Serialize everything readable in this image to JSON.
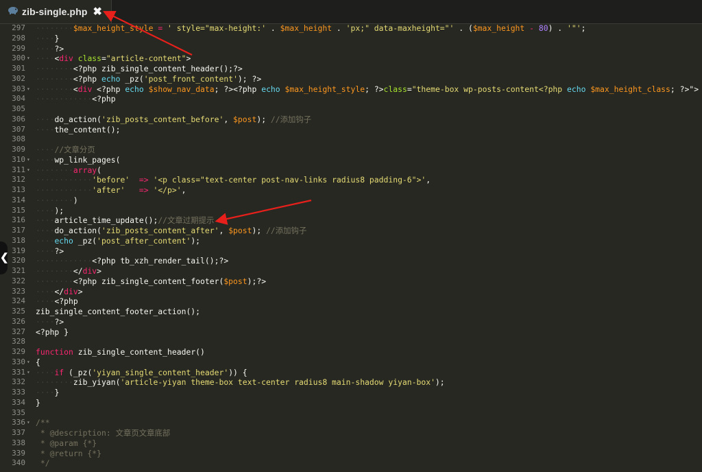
{
  "tab": {
    "icon": "php-elephant-icon",
    "label": "zib-single.php",
    "close_glyph": "✖"
  },
  "sidebar_toggle_glyph": "❮",
  "colors": {
    "background": "#272822",
    "keyword": "#f92672",
    "variable": "#fd971f",
    "string": "#e6db74",
    "comment": "#75715e",
    "echo": "#66d9ef",
    "number": "#ae81ff",
    "annotation_arrow": "#e8201b"
  },
  "lines": [
    {
      "n": "297",
      "fold": false,
      "tokens": [
        [
          "ws",
          "········"
        ],
        [
          "var",
          "$max_height_style"
        ],
        [
          "p",
          " "
        ],
        [
          "kw",
          "="
        ],
        [
          "p",
          " "
        ],
        [
          "str",
          "' style=\"max-height:'"
        ],
        [
          "p",
          " . "
        ],
        [
          "var",
          "$max_height"
        ],
        [
          "p",
          " . "
        ],
        [
          "str",
          "'px;\" data-maxheight=\"'"
        ],
        [
          "p",
          " . ("
        ],
        [
          "var",
          "$max_height"
        ],
        [
          "p",
          " "
        ],
        [
          "kw",
          "-"
        ],
        [
          "p",
          " "
        ],
        [
          "num",
          "80"
        ],
        [
          "p",
          ") . "
        ],
        [
          "str",
          "'\"'"
        ],
        [
          "p",
          ";"
        ]
      ]
    },
    {
      "n": "298",
      "fold": false,
      "tokens": [
        [
          "ws",
          "····"
        ],
        [
          "p",
          "}"
        ]
      ]
    },
    {
      "n": "299",
      "fold": false,
      "tokens": [
        [
          "ws",
          "····"
        ],
        [
          "p",
          "?>"
        ]
      ]
    },
    {
      "n": "300",
      "fold": true,
      "tokens": [
        [
          "ws",
          "····"
        ],
        [
          "p",
          "<"
        ],
        [
          "kw",
          "div"
        ],
        [
          "p",
          " "
        ],
        [
          "attr",
          "class"
        ],
        [
          "p",
          "="
        ],
        [
          "str",
          "\"article-content\""
        ],
        [
          "p",
          ">"
        ]
      ]
    },
    {
      "n": "301",
      "fold": false,
      "tokens": [
        [
          "ws",
          "········"
        ],
        [
          "p",
          "<?php zib_single_content_header();?>"
        ]
      ]
    },
    {
      "n": "302",
      "fold": false,
      "tokens": [
        [
          "ws",
          "········"
        ],
        [
          "p",
          "<?php "
        ],
        [
          "echo",
          "echo"
        ],
        [
          "p",
          " _pz("
        ],
        [
          "str",
          "'post_front_content'"
        ],
        [
          "p",
          "); ?>"
        ]
      ]
    },
    {
      "n": "303",
      "fold": true,
      "tokens": [
        [
          "ws",
          "········"
        ],
        [
          "p",
          "<"
        ],
        [
          "kw",
          "div"
        ],
        [
          "p",
          " <?php "
        ],
        [
          "echo",
          "echo"
        ],
        [
          "p",
          " "
        ],
        [
          "var",
          "$show_nav_data"
        ],
        [
          "p",
          "; ?><?php "
        ],
        [
          "echo",
          "echo"
        ],
        [
          "p",
          " "
        ],
        [
          "var",
          "$max_height_style"
        ],
        [
          "p",
          "; ?>"
        ],
        [
          "attr",
          "class"
        ],
        [
          "p",
          "="
        ],
        [
          "str",
          "\"theme-box wp-posts-content<?php "
        ],
        [
          "echo",
          "echo"
        ],
        [
          "p",
          " "
        ],
        [
          "var",
          "$max_height_class"
        ],
        [
          "p",
          "; ?>\">"
        ]
      ]
    },
    {
      "n": "304",
      "fold": false,
      "tokens": [
        [
          "ws",
          "············"
        ],
        [
          "p",
          "<?php"
        ]
      ]
    },
    {
      "n": "305",
      "fold": false,
      "tokens": []
    },
    {
      "n": "306",
      "fold": false,
      "tokens": [
        [
          "ws",
          "····"
        ],
        [
          "p",
          "do_action("
        ],
        [
          "str",
          "'zib_posts_content_before'"
        ],
        [
          "p",
          ", "
        ],
        [
          "var",
          "$post"
        ],
        [
          "p",
          "); "
        ],
        [
          "cm",
          "//添加钩子"
        ]
      ]
    },
    {
      "n": "307",
      "fold": false,
      "tokens": [
        [
          "ws",
          "····"
        ],
        [
          "p",
          "the_content();"
        ]
      ]
    },
    {
      "n": "308",
      "fold": false,
      "tokens": []
    },
    {
      "n": "309",
      "fold": false,
      "tokens": [
        [
          "ws",
          "····"
        ],
        [
          "cm",
          "//文章分页"
        ]
      ]
    },
    {
      "n": "310",
      "fold": true,
      "tokens": [
        [
          "ws",
          "····"
        ],
        [
          "p",
          "wp_link_pages("
        ]
      ]
    },
    {
      "n": "311",
      "fold": true,
      "tokens": [
        [
          "ws",
          "········"
        ],
        [
          "kw",
          "array"
        ],
        [
          "p",
          "("
        ]
      ]
    },
    {
      "n": "312",
      "fold": false,
      "tokens": [
        [
          "ws",
          "············"
        ],
        [
          "str",
          "'before'"
        ],
        [
          "p",
          "  "
        ],
        [
          "kw",
          "=>"
        ],
        [
          "p",
          " "
        ],
        [
          "str",
          "'<p class=\"text-center post-nav-links radius8 padding-6\">'"
        ],
        [
          "p",
          ","
        ]
      ]
    },
    {
      "n": "313",
      "fold": false,
      "tokens": [
        [
          "ws",
          "············"
        ],
        [
          "str",
          "'after'"
        ],
        [
          "p",
          "   "
        ],
        [
          "kw",
          "=>"
        ],
        [
          "p",
          " "
        ],
        [
          "str",
          "'</p>'"
        ],
        [
          "p",
          ","
        ]
      ]
    },
    {
      "n": "314",
      "fold": false,
      "tokens": [
        [
          "ws",
          "········"
        ],
        [
          "p",
          ")"
        ]
      ]
    },
    {
      "n": "315",
      "fold": false,
      "tokens": [
        [
          "ws",
          "····"
        ],
        [
          "p",
          ");"
        ]
      ]
    },
    {
      "n": "316",
      "fold": false,
      "tokens": [
        [
          "ws",
          "····"
        ],
        [
          "p",
          "article_time_update();"
        ],
        [
          "cm",
          "//文章过期提示"
        ]
      ]
    },
    {
      "n": "317",
      "fold": false,
      "tokens": [
        [
          "ws",
          "····"
        ],
        [
          "p",
          "do_action("
        ],
        [
          "str",
          "'zib_posts_content_after'"
        ],
        [
          "p",
          ", "
        ],
        [
          "var",
          "$post"
        ],
        [
          "p",
          "); "
        ],
        [
          "cm",
          "//添加钩子"
        ]
      ]
    },
    {
      "n": "318",
      "fold": false,
      "tokens": [
        [
          "ws",
          "····"
        ],
        [
          "echo",
          "echo"
        ],
        [
          "p",
          " _pz("
        ],
        [
          "str",
          "'post_after_content'"
        ],
        [
          "p",
          ");"
        ]
      ]
    },
    {
      "n": "319",
      "fold": false,
      "tokens": [
        [
          "ws",
          "····"
        ],
        [
          "p",
          "?>"
        ]
      ]
    },
    {
      "n": "320",
      "fold": false,
      "tokens": [
        [
          "ws",
          "············"
        ],
        [
          "p",
          "<?php tb_xzh_render_tail();?>"
        ]
      ]
    },
    {
      "n": "321",
      "fold": false,
      "tokens": [
        [
          "ws",
          "········"
        ],
        [
          "p",
          "</"
        ],
        [
          "kw",
          "div"
        ],
        [
          "p",
          ">"
        ]
      ]
    },
    {
      "n": "322",
      "fold": false,
      "tokens": [
        [
          "ws",
          "········"
        ],
        [
          "p",
          "<?php zib_single_content_footer("
        ],
        [
          "var",
          "$post"
        ],
        [
          "p",
          ");?>"
        ]
      ]
    },
    {
      "n": "323",
      "fold": false,
      "tokens": [
        [
          "ws",
          "····"
        ],
        [
          "p",
          "</"
        ],
        [
          "kw",
          "div"
        ],
        [
          "p",
          ">"
        ]
      ]
    },
    {
      "n": "324",
      "fold": false,
      "tokens": [
        [
          "ws",
          "····"
        ],
        [
          "p",
          "<?php"
        ]
      ]
    },
    {
      "n": "325",
      "fold": false,
      "tokens": [
        [
          "p",
          "zib_single_content_footer_action();"
        ]
      ]
    },
    {
      "n": "326",
      "fold": false,
      "tokens": [
        [
          "ws",
          "····"
        ],
        [
          "p",
          "?>"
        ]
      ]
    },
    {
      "n": "327",
      "fold": false,
      "tokens": [
        [
          "p",
          "<?php }"
        ]
      ]
    },
    {
      "n": "328",
      "fold": false,
      "tokens": []
    },
    {
      "n": "329",
      "fold": false,
      "tokens": [
        [
          "kw",
          "function"
        ],
        [
          "p",
          " zib_single_content_header()"
        ]
      ]
    },
    {
      "n": "330",
      "fold": true,
      "tokens": [
        [
          "p",
          "{"
        ]
      ]
    },
    {
      "n": "331",
      "fold": true,
      "tokens": [
        [
          "ws",
          "····"
        ],
        [
          "kw",
          "if"
        ],
        [
          "p",
          " (_pz("
        ],
        [
          "str",
          "'yiyan_single_content_header'"
        ],
        [
          "p",
          ")) {"
        ]
      ]
    },
    {
      "n": "332",
      "fold": false,
      "tokens": [
        [
          "ws",
          "········"
        ],
        [
          "p",
          "zib_yiyan("
        ],
        [
          "str",
          "'article-yiyan theme-box text-center radius8 main-shadow yiyan-box'"
        ],
        [
          "p",
          ");"
        ]
      ]
    },
    {
      "n": "333",
      "fold": false,
      "tokens": [
        [
          "ws",
          "····"
        ],
        [
          "p",
          "}"
        ]
      ]
    },
    {
      "n": "334",
      "fold": false,
      "tokens": [
        [
          "p",
          "}"
        ]
      ]
    },
    {
      "n": "335",
      "fold": false,
      "tokens": []
    },
    {
      "n": "336",
      "fold": true,
      "tokens": [
        [
          "cm",
          "/**"
        ]
      ]
    },
    {
      "n": "337",
      "fold": false,
      "tokens": [
        [
          "cm",
          " * @description: 文章页文章底部"
        ]
      ]
    },
    {
      "n": "338",
      "fold": false,
      "tokens": [
        [
          "cm",
          " * @param {*}"
        ]
      ]
    },
    {
      "n": "339",
      "fold": false,
      "tokens": [
        [
          "cm",
          " * @return {*}"
        ]
      ]
    },
    {
      "n": "340",
      "fold": false,
      "tokens": [
        [
          "cm",
          " */"
        ]
      ]
    }
  ]
}
